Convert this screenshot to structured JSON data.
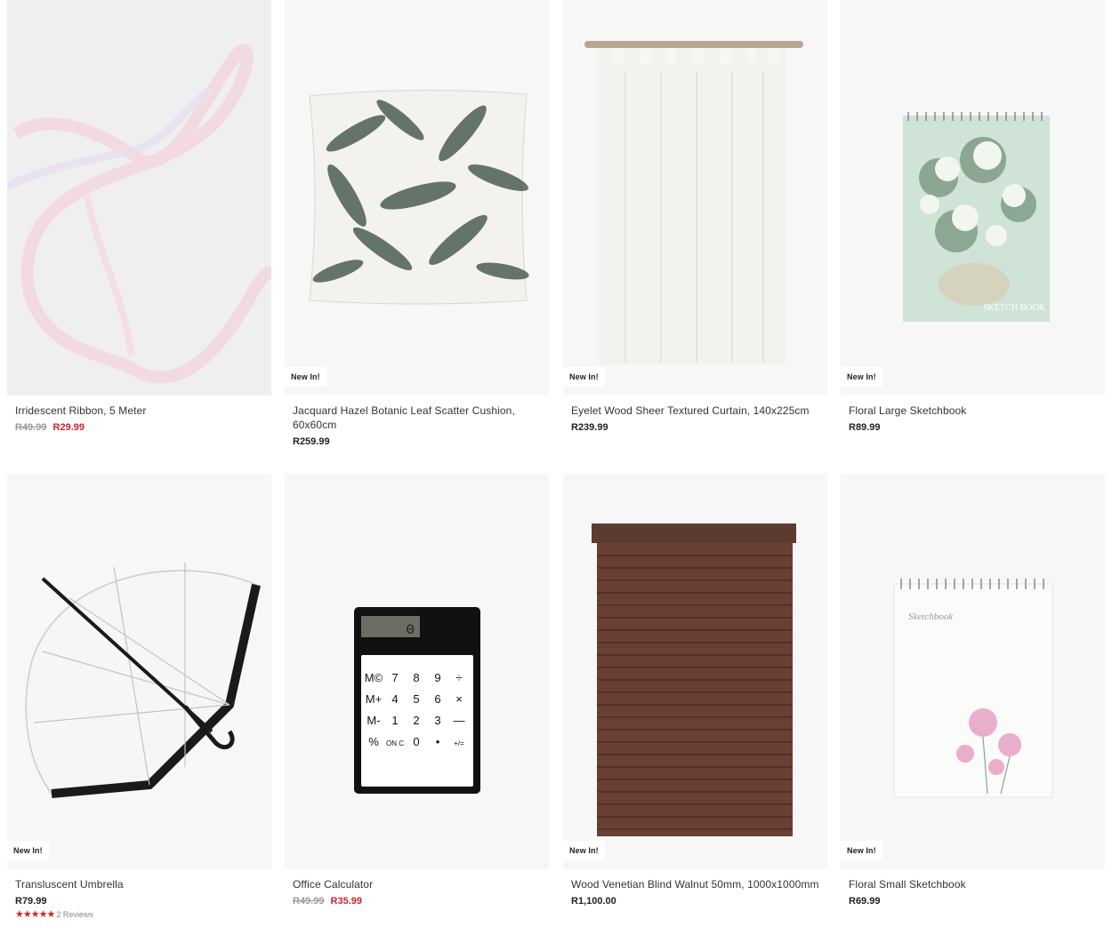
{
  "products": [
    {
      "name": "Irridescent Ribbon, 5 Meter",
      "was_price": "R49.99",
      "price": "R29.99",
      "badge": "",
      "image": "iridescent-ribbon"
    },
    {
      "name": "Jacquard Hazel Botanic Leaf Scatter Cushion, 60x60cm",
      "was_price": "",
      "price": "R259.99",
      "badge": "New In!",
      "image": "leaf-cushion"
    },
    {
      "name": "Eyelet Wood Sheer Textured Curtain, 140x225cm",
      "was_price": "",
      "price": "R239.99",
      "badge": "New In!",
      "image": "sheer-curtain"
    },
    {
      "name": "Floral Large Sketchbook",
      "was_price": "",
      "price": "R89.99",
      "badge": "New In!",
      "image": "floral-sketchbook",
      "cover_text": "SKETCH BOOK"
    },
    {
      "name": "Transluscent Umbrella",
      "was_price": "",
      "price": "R79.99",
      "badge": "New In!",
      "image": "clear-umbrella",
      "rating_stars": 5,
      "reviews": "2 Reviews"
    },
    {
      "name": "Office Calculator",
      "was_price": "R49.99",
      "price": "R35.99",
      "badge": "",
      "image": "calculator",
      "calculator_display": "0",
      "calculator_keys": [
        "M©",
        "7",
        "8",
        "9",
        "÷",
        "M+",
        "4",
        "5",
        "6",
        "×",
        "M-",
        "1",
        "2",
        "3",
        "—",
        "%",
        "ON.C",
        "0",
        "•",
        "+/="
      ]
    },
    {
      "name": "Wood Venetian Blind Walnut 50mm, 1000x1000mm",
      "was_price": "",
      "price": "R1,100.00",
      "badge": "New In!",
      "image": "wood-blind"
    },
    {
      "name": "Floral Small Sketchbook",
      "was_price": "",
      "price": "R69.99",
      "badge": "New In!",
      "image": "small-sketchbook",
      "cover_text": "Sketchbook"
    }
  ],
  "colors": {
    "sale": "#c8272e",
    "was": "#9a9a9a",
    "tile": "#f7f7f7"
  }
}
